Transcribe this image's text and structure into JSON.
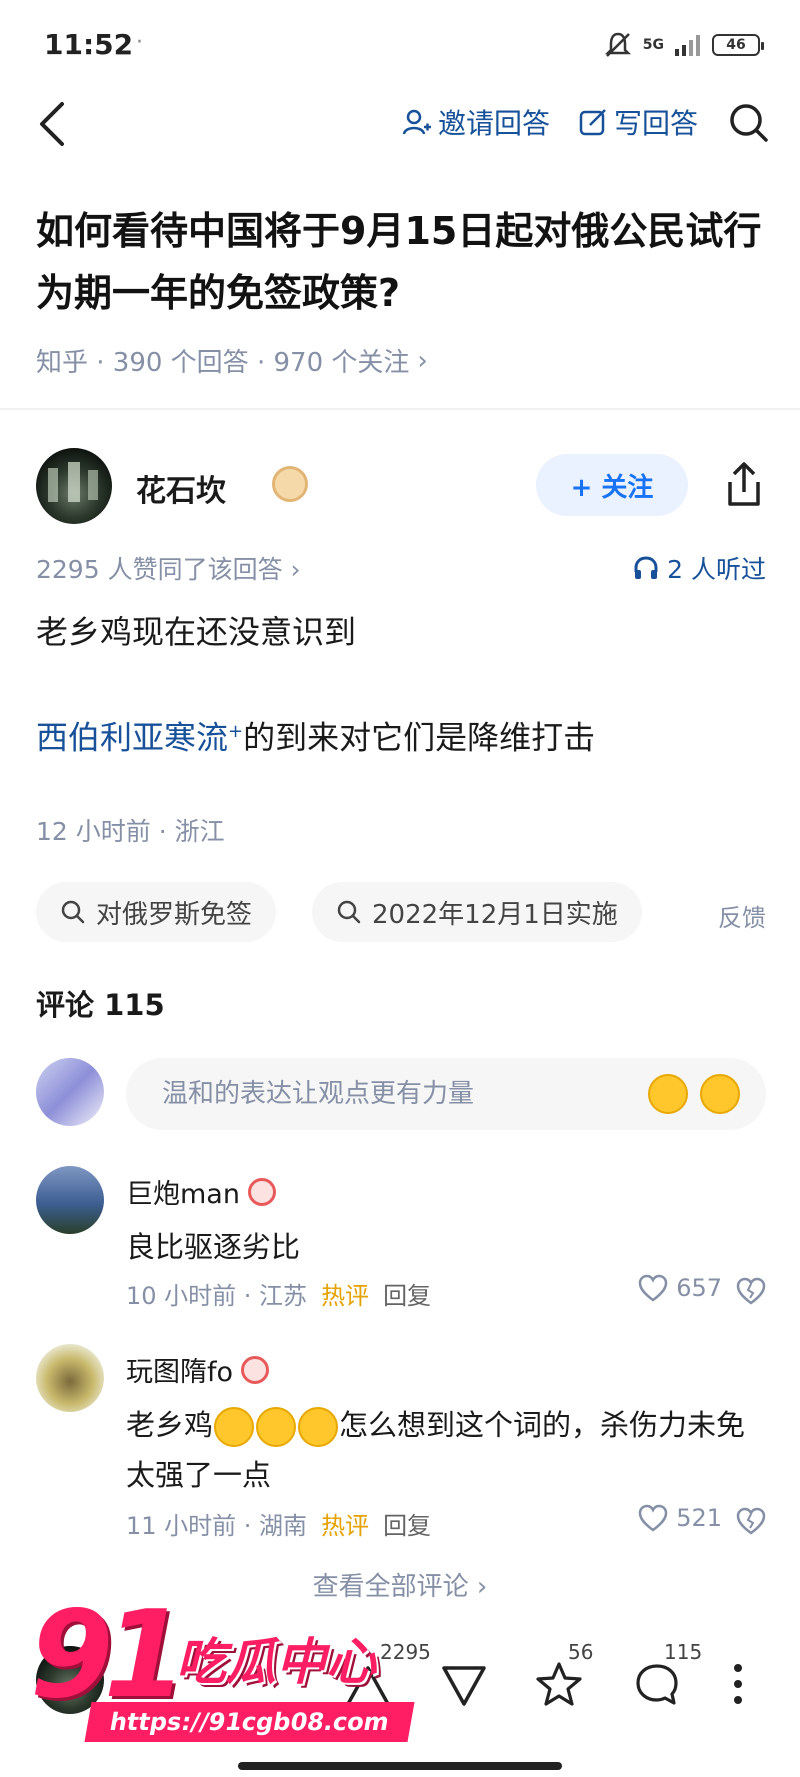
{
  "status_bar": {
    "time": "11:52",
    "dot": "·",
    "network": "5G",
    "battery": "46"
  },
  "nav": {
    "invite_label": "邀请回答",
    "write_label": "写回答"
  },
  "question": {
    "title": "如何看待中国将于9月15日起对俄公民试行为期一年的免签政策?",
    "meta": "知乎 · 390 个回答 · 970 个关注",
    "meta_chevron": "›"
  },
  "answer": {
    "author": "花石坎",
    "follow_label": "+ 关注",
    "stats": "2295 人赞同了该回答 ›",
    "listen": "2 人听过",
    "line1": "老乡鸡现在还没意识到",
    "link_term": "西伯利亚寒流",
    "link_sup": "+",
    "line2_rest": "的到来对它们是降维打击",
    "time_location": "12 小时前 · 浙江"
  },
  "tags": [
    {
      "label": "对俄罗斯免签"
    },
    {
      "label": "2022年12月1日实施"
    }
  ],
  "feedback_label": "反馈",
  "comments": {
    "title": "评论 115",
    "input_placeholder": "温和的表达让观点更有力量",
    "items": [
      {
        "name": "巨炮man",
        "text": "良比驱逐劣比",
        "time_location": "10 小时前 · 江苏",
        "hot": "热评",
        "reply": "回复",
        "likes": "657"
      },
      {
        "name": "玩图隋fo",
        "text_before": "老乡鸡",
        "text_after": "怎么想到这个词的，杀伤力未免太强了一点",
        "time_location": "11 小时前 · 湖南",
        "hot": "热评",
        "reply": "回复",
        "likes": "521"
      }
    ],
    "view_all": "查看全部评论 ›"
  },
  "bottom_bar": {
    "upvote_count": "2295",
    "favorite_count": "56",
    "comment_count": "115"
  },
  "watermark": {
    "number": "91",
    "name": "吃瓜中心",
    "url": "https://91cgb08.com"
  },
  "colors": {
    "link_blue": "#175199",
    "follow_blue": "#1772f6",
    "meta_gray": "#8590a6",
    "hot_gold": "#e5a200",
    "brand_pink": "#ff1e63"
  }
}
